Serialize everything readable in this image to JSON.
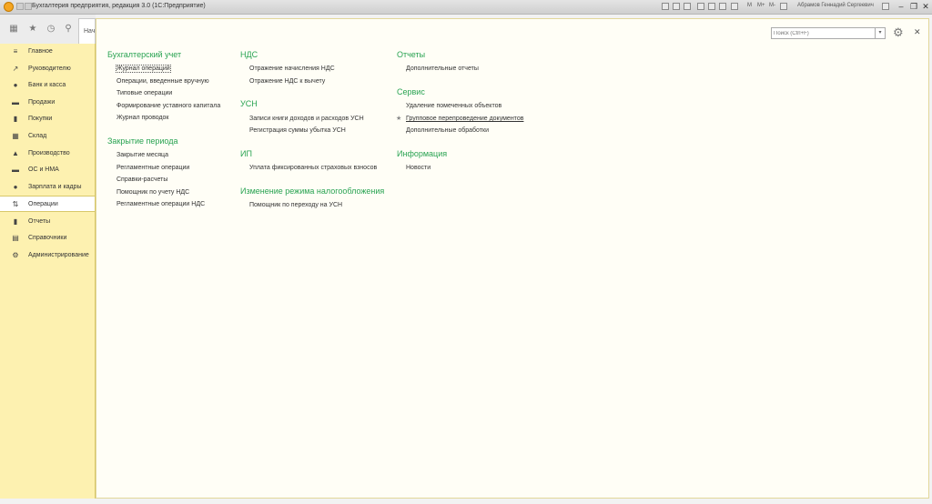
{
  "window": {
    "title": "Бухгалтерия предприятия, редакция 3.0  (1С:Предприятие)",
    "user": "Абрамов Геннадий Сергеевич",
    "m_labels": [
      "M",
      "M+",
      "M-"
    ]
  },
  "toolstrip": {
    "start_tab_label": "Нач"
  },
  "sidebar": {
    "items": [
      {
        "label": "Главное",
        "icon": "≡"
      },
      {
        "label": "Руководителю",
        "icon": "↗"
      },
      {
        "label": "Банк и касса",
        "icon": "●"
      },
      {
        "label": "Продажи",
        "icon": "▬"
      },
      {
        "label": "Покупки",
        "icon": "▮"
      },
      {
        "label": "Склад",
        "icon": "▦"
      },
      {
        "label": "Производство",
        "icon": "▲"
      },
      {
        "label": "ОС и НМА",
        "icon": "▬"
      },
      {
        "label": "Зарплата и кадры",
        "icon": "●"
      },
      {
        "label": "Операции",
        "icon": "⇅"
      },
      {
        "label": "Отчеты",
        "icon": "▮"
      },
      {
        "label": "Справочники",
        "icon": "▤"
      },
      {
        "label": "Администрирование",
        "icon": "⚙"
      }
    ]
  },
  "search": {
    "placeholder": "Поиск (Ctrl+F)"
  },
  "sections": {
    "buh": {
      "title": "Бухгалтерский учет",
      "links": [
        "Журнал операций",
        "Операции, введенные вручную",
        "Типовые операции",
        "Формирование уставного капитала",
        "Журнал проводок"
      ]
    },
    "period": {
      "title": "Закрытие периода",
      "links": [
        "Закрытие месяца",
        "Регламентные операции",
        "Справки-расчеты",
        "Помощник по учету НДС",
        "Регламентные операции НДС"
      ]
    },
    "nds": {
      "title": "НДС",
      "links": [
        "Отражение начисления НДС",
        "Отражение НДС к вычету"
      ]
    },
    "usn": {
      "title": "УСН",
      "links": [
        "Записи книги доходов и расходов УСН",
        "Регистрация суммы убытка УСН"
      ]
    },
    "ip": {
      "title": "ИП",
      "links": [
        "Уплата фиксированных страховых взносов"
      ]
    },
    "regime": {
      "title": "Изменение режима налогообложения",
      "links": [
        "Помощник по переходу на УСН"
      ]
    },
    "reports": {
      "title": "Отчеты",
      "links": [
        "Дополнительные отчеты"
      ]
    },
    "service": {
      "title": "Сервис",
      "links": [
        "Удаление помеченных объектов",
        "Групповое перепроведение документов",
        "Дополнительные обработки"
      ]
    },
    "info": {
      "title": "Информация",
      "links": [
        "Новости"
      ]
    }
  }
}
